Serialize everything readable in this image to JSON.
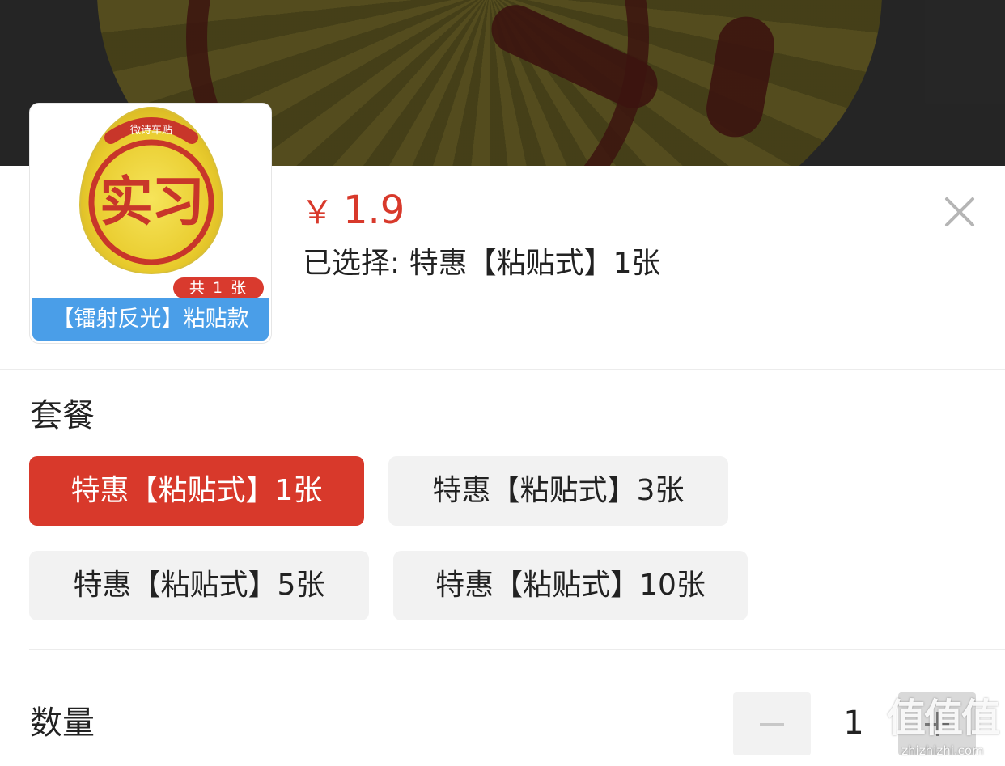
{
  "product": {
    "price_currency": "￥",
    "price_value": "1.9",
    "selected_prefix": "已选择:",
    "selected_value": "特惠【粘贴式】1张",
    "thumbnail": {
      "sticker_text": "实习",
      "sticker_top_text": "微诗车贴",
      "count_badge": "共 1 张",
      "caption": "【镭射反光】粘贴款"
    }
  },
  "package": {
    "title": "套餐",
    "options": [
      {
        "label": "特惠【粘贴式】1张",
        "selected": true
      },
      {
        "label": "特惠【粘贴式】3张",
        "selected": false
      },
      {
        "label": "特惠【粘贴式】5张",
        "selected": false
      },
      {
        "label": "特惠【粘贴式】10张",
        "selected": false
      }
    ]
  },
  "quantity": {
    "label": "数量",
    "value": "1"
  },
  "watermark": {
    "logo": "值值值",
    "url": "zhizhizhi.com"
  },
  "colors": {
    "accent": "#d8392b",
    "caption_blue": "#4a9ee8",
    "option_bg": "#f2f2f2"
  },
  "icons": {
    "close": "close-icon",
    "minus": "minus-icon",
    "plus": "plus-icon"
  }
}
